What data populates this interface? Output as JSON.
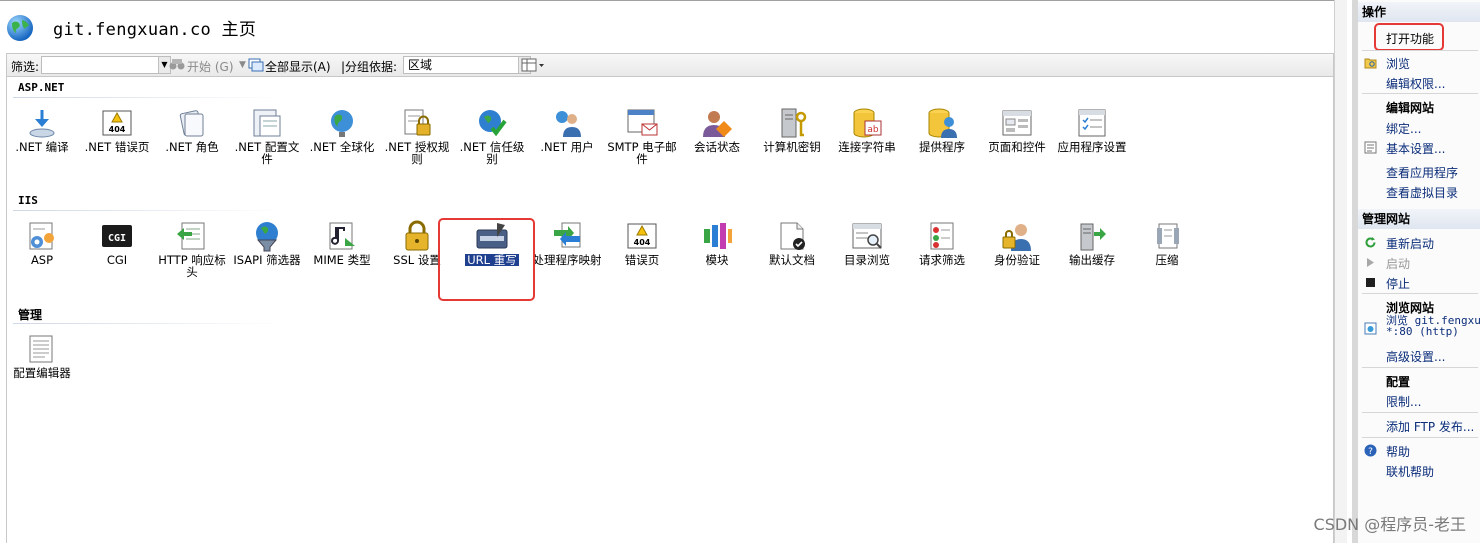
{
  "header": {
    "title": "git.fengxuan.co 主页"
  },
  "toolbar": {
    "filter_label": "筛选:",
    "start_label": "开始",
    "start_key": "(G)",
    "show_all_label": "全部显示(A)",
    "group_by_label": "|分组依据:",
    "group_by_value": "区域"
  },
  "sections": {
    "aspnet": {
      "title": "ASP.NET",
      "items": [
        {
          "label": ".NET 编译",
          "icon": "compile-icon"
        },
        {
          "label": ".NET 错误页",
          "icon": "error-page-404-icon"
        },
        {
          "label": ".NET 角色",
          "icon": "roles-icon"
        },
        {
          "label": ".NET 配置文件",
          "icon": "profile-icon"
        },
        {
          "label": ".NET 全球化",
          "icon": "globalization-icon"
        },
        {
          "label": ".NET 授权规则",
          "icon": "authorization-icon"
        },
        {
          "label": ".NET 信任级别",
          "icon": "trust-level-icon"
        },
        {
          "label": ".NET 用户",
          "icon": "users-icon"
        },
        {
          "label": "SMTP 电子邮件",
          "icon": "smtp-email-icon"
        },
        {
          "label": "会话状态",
          "icon": "session-state-icon"
        },
        {
          "label": "计算机密钥",
          "icon": "machine-key-icon"
        },
        {
          "label": "连接字符串",
          "icon": "connection-strings-icon"
        },
        {
          "label": "提供程序",
          "icon": "providers-icon"
        },
        {
          "label": "页面和控件",
          "icon": "pages-controls-icon"
        },
        {
          "label": "应用程序设置",
          "icon": "app-settings-icon"
        }
      ]
    },
    "iis": {
      "title": "IIS",
      "items": [
        {
          "label": "ASP",
          "icon": "asp-icon"
        },
        {
          "label": "CGI",
          "icon": "cgi-icon"
        },
        {
          "label": "HTTP 响应标头",
          "icon": "http-headers-icon"
        },
        {
          "label": "ISAPI 筛选器",
          "icon": "isapi-filters-icon"
        },
        {
          "label": "MIME 类型",
          "icon": "mime-types-icon"
        },
        {
          "label": "SSL 设置",
          "icon": "ssl-lock-icon"
        },
        {
          "label": "URL 重写",
          "icon": "url-rewrite-icon"
        },
        {
          "label": "处理程序映射",
          "icon": "handler-mappings-icon"
        },
        {
          "label": "错误页",
          "icon": "error-pages-icon"
        },
        {
          "label": "模块",
          "icon": "modules-icon"
        },
        {
          "label": "默认文档",
          "icon": "default-document-icon"
        },
        {
          "label": "目录浏览",
          "icon": "directory-browsing-icon"
        },
        {
          "label": "请求筛选",
          "icon": "request-filtering-icon"
        },
        {
          "label": "身份验证",
          "icon": "authentication-icon"
        },
        {
          "label": "输出缓存",
          "icon": "output-caching-icon"
        },
        {
          "label": "压缩",
          "icon": "compression-icon"
        }
      ]
    },
    "manage": {
      "title": "管理",
      "items": [
        {
          "label": "配置编辑器",
          "icon": "config-editor-icon"
        }
      ]
    }
  },
  "actions": {
    "title": "操作",
    "open_feature": "打开功能",
    "explore": "浏览",
    "edit_permissions": "编辑权限...",
    "edit_site": "编辑网站",
    "bindings": "绑定...",
    "basic_settings": "基本设置...",
    "view_apps": "查看应用程序",
    "view_vdirs": "查看虚拟目录",
    "manage_site": "管理网站",
    "restart": "重新启动",
    "start": "启动",
    "stop": "停止",
    "browse_site": "浏览网站",
    "browse_link": "浏览 git.fengxuan",
    "browse_port": "*:80 (http)",
    "advanced_settings": "高级设置...",
    "configure": "配置",
    "limits": "限制...",
    "add_ftp": "添加 FTP 发布...",
    "help": "帮助",
    "online_help": "联机帮助"
  },
  "watermark": "CSDN @程序员-老王"
}
